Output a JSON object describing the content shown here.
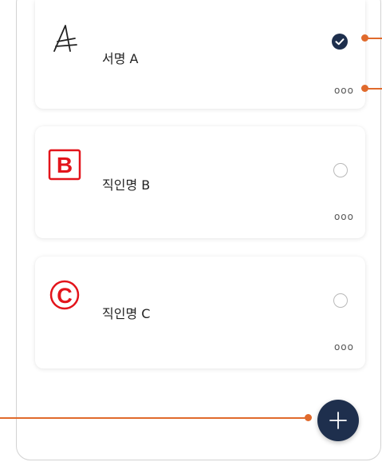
{
  "signatures": [
    {
      "name": "서명 A",
      "selected": true,
      "icon": "handwritten-signature-a"
    },
    {
      "name": "직인명 B",
      "selected": false,
      "icon": "stamp-b"
    },
    {
      "name": "직인명 C",
      "selected": false,
      "icon": "stamp-c"
    }
  ],
  "more_label": "ooo",
  "fab_icon": "plus-icon",
  "colors": {
    "accent": "#1e2f4d",
    "annotation": "#e06a2c",
    "stamp_red": "#e3141b"
  }
}
